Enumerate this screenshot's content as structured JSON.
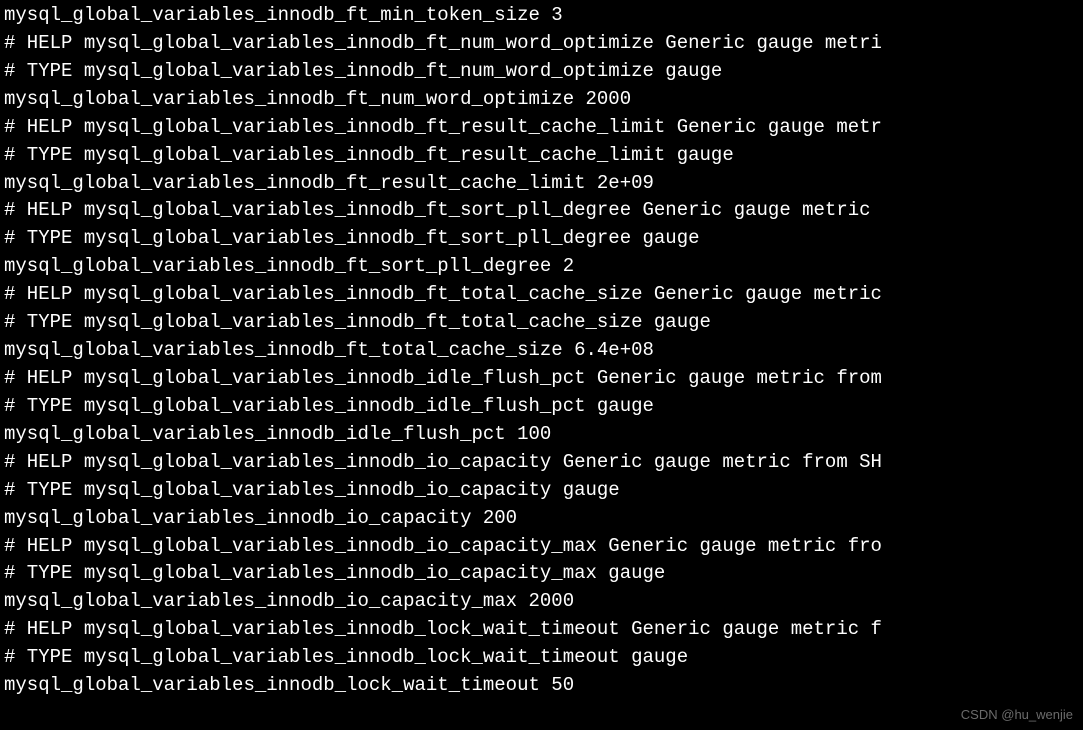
{
  "terminal": {
    "lines": [
      "mysql_global_variables_innodb_ft_min_token_size 3",
      "# HELP mysql_global_variables_innodb_ft_num_word_optimize Generic gauge metri",
      "# TYPE mysql_global_variables_innodb_ft_num_word_optimize gauge",
      "mysql_global_variables_innodb_ft_num_word_optimize 2000",
      "# HELP mysql_global_variables_innodb_ft_result_cache_limit Generic gauge metr",
      "# TYPE mysql_global_variables_innodb_ft_result_cache_limit gauge",
      "mysql_global_variables_innodb_ft_result_cache_limit 2e+09",
      "# HELP mysql_global_variables_innodb_ft_sort_pll_degree Generic gauge metric ",
      "# TYPE mysql_global_variables_innodb_ft_sort_pll_degree gauge",
      "mysql_global_variables_innodb_ft_sort_pll_degree 2",
      "# HELP mysql_global_variables_innodb_ft_total_cache_size Generic gauge metric",
      "# TYPE mysql_global_variables_innodb_ft_total_cache_size gauge",
      "mysql_global_variables_innodb_ft_total_cache_size 6.4e+08",
      "# HELP mysql_global_variables_innodb_idle_flush_pct Generic gauge metric from",
      "# TYPE mysql_global_variables_innodb_idle_flush_pct gauge",
      "mysql_global_variables_innodb_idle_flush_pct 100",
      "# HELP mysql_global_variables_innodb_io_capacity Generic gauge metric from SH",
      "# TYPE mysql_global_variables_innodb_io_capacity gauge",
      "mysql_global_variables_innodb_io_capacity 200",
      "# HELP mysql_global_variables_innodb_io_capacity_max Generic gauge metric fro",
      "# TYPE mysql_global_variables_innodb_io_capacity_max gauge",
      "mysql_global_variables_innodb_io_capacity_max 2000",
      "# HELP mysql_global_variables_innodb_lock_wait_timeout Generic gauge metric f",
      "# TYPE mysql_global_variables_innodb_lock_wait_timeout gauge",
      "mysql_global_variables_innodb_lock_wait_timeout 50"
    ]
  },
  "watermark": "CSDN @hu_wenjie"
}
